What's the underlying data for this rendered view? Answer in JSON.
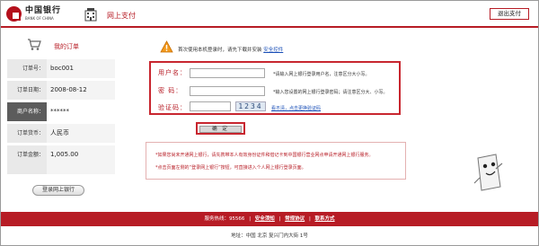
{
  "header": {
    "bank_name_cn": "中国银行",
    "bank_name_en": "BANK OF CHINA",
    "title": "网上支付",
    "exit_label": "退出支付"
  },
  "order": {
    "title": "我的订单",
    "rows": [
      {
        "label": "订单号：",
        "value": "boc001"
      },
      {
        "label": "订单日期：",
        "value": "2008-08-12"
      },
      {
        "label": "商户名称：",
        "value": "******"
      },
      {
        "label": "订单货币：",
        "value": "人民币"
      },
      {
        "label": "订单金额：",
        "value": "1,005.00"
      }
    ],
    "login_button": "登录网上银行"
  },
  "notice": {
    "text": "首次使用本机登录时，请先下载并安装",
    "link": "安全控件"
  },
  "form": {
    "username_label": "用户名：",
    "username_hint": "*请输入网上银行登录用户名，注意区分大小写。",
    "password_label": "密  码：",
    "password_hint": "*输入您设置的网上银行登录密码；请注意区分大、小写。",
    "captcha_label": "验证码：",
    "captcha_text": "1234",
    "captcha_refresh": "看不清，点击更换验证码",
    "confirm_label": "确 定"
  },
  "tips": {
    "line1": "*如果您尚未开通网上银行，请先携带本人有效身份证件和借记卡到中国银行营业网点申请开通网上银行服务。",
    "line2": "*点击页面左侧的“登录网上银行”按钮，可直接进入个人网上银行登录页面。"
  },
  "footer": {
    "hotline": "服务热线：95566",
    "links": [
      "安全须知",
      "常规协议",
      "联系方式"
    ],
    "address": "地址：中国 北京 复兴门内大街 1号"
  },
  "colors": {
    "brand_red": "#b71c25",
    "link_blue": "#1a4fb7"
  }
}
